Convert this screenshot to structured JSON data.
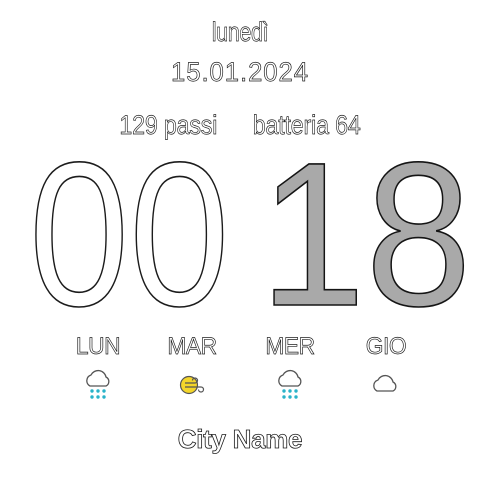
{
  "header": {
    "day_name": "lunedì",
    "date": "15.01.2024"
  },
  "stats": {
    "steps_value": "129",
    "steps_label": "passi",
    "battery_label": "batteria",
    "battery_value": "64"
  },
  "clock": {
    "hours": "00",
    "minutes": "18"
  },
  "forecast": [
    {
      "label": "LUN",
      "icon": "rain-cloud-icon"
    },
    {
      "label": "MAR",
      "icon": "sun-wind-icon"
    },
    {
      "label": "MER",
      "icon": "rain-cloud-icon"
    },
    {
      "label": "GIO",
      "icon": "cloud-icon"
    }
  ],
  "colors": {
    "rain_drops": "#2ab3c9",
    "sun": "#f4d62a",
    "minutes_fill": "#a9a9a9"
  },
  "city": "City Name"
}
